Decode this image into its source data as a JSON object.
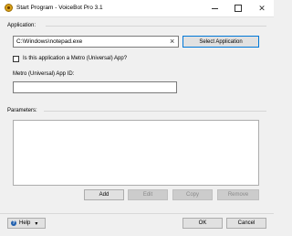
{
  "window": {
    "title": "Start Program - VoiceBot Pro 3.1",
    "minimize_glyph": "",
    "maximize_glyph": "",
    "close_glyph": "✕"
  },
  "application": {
    "label": "Application:",
    "path_value": "C:\\Windows\\notepad.exe",
    "clear_glyph": "×",
    "select_button": "Select Application"
  },
  "metro": {
    "checkbox_label": "Is this application a Metro (Universal) App?",
    "checked": false,
    "app_id_label": "Metro (Universal) App ID:",
    "app_id_value": ""
  },
  "parameters": {
    "label": "Parameters:",
    "items": [],
    "add_button": "Add",
    "edit_button": "Edit",
    "copy_button": "Copy",
    "remove_button": "Remove"
  },
  "footer": {
    "help_button": "Help",
    "help_dropdown_glyph": "▾",
    "ok_button": "OK",
    "cancel_button": "Cancel"
  },
  "colors": {
    "accent": "#0078d7",
    "background": "#f0f0f0",
    "icon": "#d9a21a"
  }
}
